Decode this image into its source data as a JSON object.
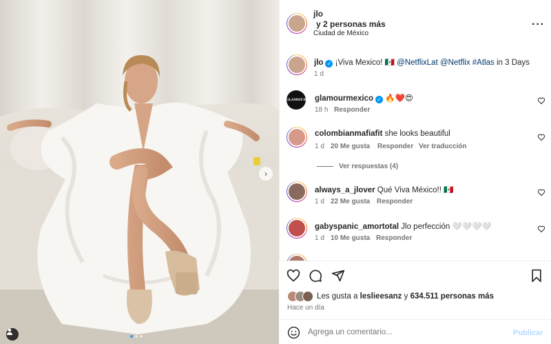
{
  "post_header": {
    "username": "jlo",
    "collaborators": "y 2 personas más",
    "location": "Ciudad de México",
    "more_icon": "more-horizontal-icon"
  },
  "caption": {
    "username": "jlo",
    "verified": true,
    "text": "¡Viva Mexico! 🇲🇽",
    "mentions": "@NetflixLat @Netflix #Atlas",
    "text_end": "in 3 Days",
    "time": "1 d"
  },
  "comments": [
    {
      "username": "glamourmexico",
      "verified": true,
      "text": "🔥❤️😍",
      "time": "18 h",
      "likes": "",
      "reply": "Responder",
      "translate": ""
    },
    {
      "username": "colombianmafiafit",
      "verified": false,
      "text": "she looks beautiful",
      "time": "1 d",
      "likes": "20 Me gusta",
      "reply": "Responder",
      "translate": "Ver traducción"
    },
    {
      "username": "always_a_jlover",
      "verified": false,
      "text": "Qué Viva México!! 🇲🇽",
      "time": "1 d",
      "likes": "22 Me gusta",
      "reply": "Responder",
      "translate": ""
    },
    {
      "username": "gabyspanic_amortotal",
      "verified": false,
      "text": "Jlo perfección 🤍🤍🤍🤍",
      "time": "1 d",
      "likes": "10 Me gusta",
      "reply": "Responder",
      "translate": ""
    }
  ],
  "view_replies": "Ver respuestas (4)",
  "likes_line": {
    "prefix": "Les gusta a",
    "user": "leslieesanz",
    "connector": "y",
    "count": "634.511 personas más"
  },
  "post_time": "Hace un día",
  "comment_input": {
    "placeholder": "Agrega un comentario...",
    "submit": "Publicar"
  },
  "icons": {
    "like": "heart-icon",
    "comment": "comment-icon",
    "share": "share-icon",
    "save": "bookmark-icon",
    "emoji": "emoji-icon"
  },
  "carousel": {
    "total": 3,
    "active": 0
  },
  "colors": {
    "accent": "#0095f6",
    "link": "#00376b",
    "muted": "#737373",
    "submit_disabled": "#b3dbff"
  }
}
